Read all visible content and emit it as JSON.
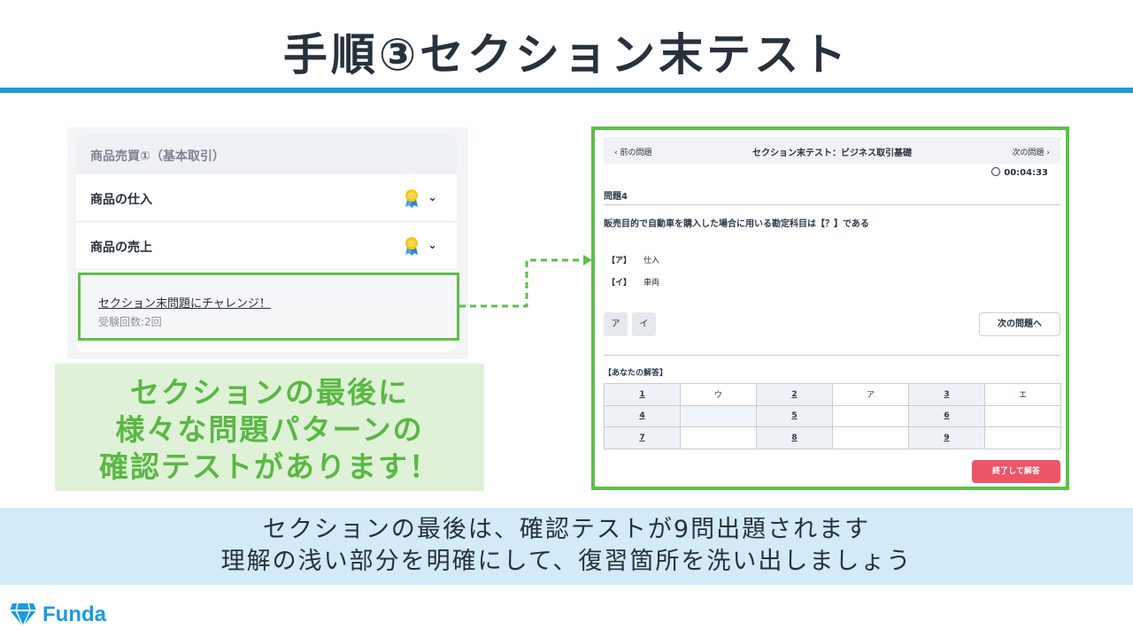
{
  "title": "手順③セクション末テスト",
  "course": {
    "header": "商品売買①（基本取引）",
    "lessons": [
      {
        "label": "商品の仕入"
      },
      {
        "label": "商品の売上"
      }
    ],
    "challenge_link": "セクション末問題にチャレンジ！",
    "challenge_count": "受験回数:2回"
  },
  "callout": {
    "lines": [
      "セクションの最後に",
      "様々な問題パターンの",
      "確認テストがあります！"
    ]
  },
  "test": {
    "prev": "‹ 前の問題",
    "title": "セクション末テスト：ビジネス取引基礎",
    "next": "次の問題 ›",
    "timer": "00:04:33",
    "question_number": "問題4",
    "question_text": "販売目的で自動車を購入した場合に用いる勘定科目は【？】である",
    "choices": [
      {
        "key": "【ア】",
        "text": "仕入"
      },
      {
        "key": "【イ】",
        "text": "車両"
      }
    ],
    "answer_buttons": [
      "ア",
      "イ"
    ],
    "next_question_button": "次の問題へ",
    "your_answers_label": "【あなたの解答】",
    "answers": [
      [
        "1",
        "ウ",
        "2",
        "ア",
        "3",
        "エ"
      ],
      [
        "4",
        "",
        "5",
        "",
        "6",
        ""
      ],
      [
        "7",
        "",
        "8",
        "",
        "9",
        ""
      ]
    ],
    "finish_button": "終了して解答"
  },
  "banner": {
    "lines": [
      "セクションの最後は、確認テストが9問出題されます",
      "理解の浅い部分を明確にして、復習箇所を洗い出しましょう"
    ]
  },
  "logo": {
    "text": "Funda"
  },
  "colors": {
    "accent_blue": "#1a9be3",
    "highlight_green": "#5cbf4a",
    "callout_bg": "#dff2d8",
    "banner_bg": "#d3ebf8",
    "finish_red": "#ee5468"
  }
}
